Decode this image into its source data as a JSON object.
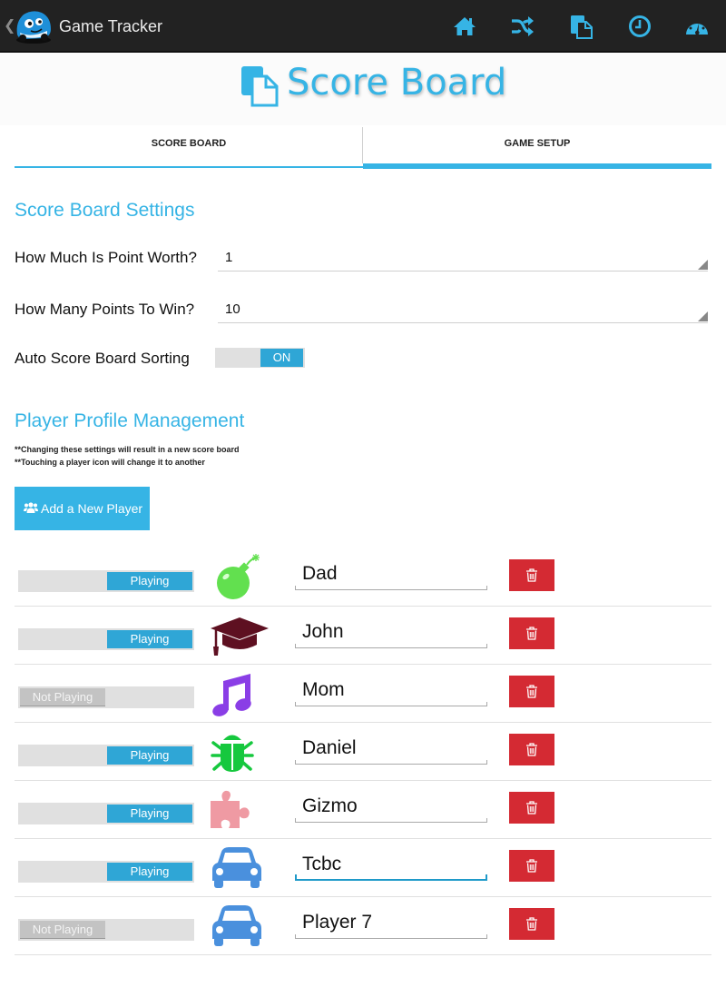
{
  "action_bar": {
    "title": "Game Tracker",
    "back_icon": "chevron-left-icon",
    "logo_icon": "car-mascot-icon",
    "actions": [
      {
        "name": "home",
        "icon": "home-icon"
      },
      {
        "name": "shuffle",
        "icon": "shuffle-icon"
      },
      {
        "name": "score-board",
        "icon": "documents-icon"
      },
      {
        "name": "history",
        "icon": "clock-icon"
      },
      {
        "name": "dashboard",
        "icon": "speedometer-icon"
      }
    ],
    "accent": "#36b4e5"
  },
  "header": {
    "title": "Score Board",
    "icon": "documents-icon"
  },
  "tabs": [
    {
      "label": "SCORE BOARD",
      "selected": false
    },
    {
      "label": "GAME SETUP",
      "selected": true
    }
  ],
  "settings": {
    "section_title": "Score Board Settings",
    "point_worth": {
      "label": "How Much Is Point Worth?",
      "value": "1"
    },
    "points_to_win": {
      "label": "How Many Points To Win?",
      "value": "10"
    },
    "auto_sort": {
      "label": "Auto Score Board Sorting",
      "state": "ON"
    }
  },
  "players_section": {
    "title": "Player Profile Management",
    "notes": [
      "**Changing these settings will result in a new score board",
      "**Touching a player icon will change it to another"
    ],
    "add_button": {
      "label": "Add a New Player",
      "icon": "users-icon"
    },
    "players": [
      {
        "status": "Playing",
        "playing": true,
        "icon": "bomb-icon",
        "icon_color": "#62e04f",
        "name": "Dad",
        "focused": false
      },
      {
        "status": "Playing",
        "playing": true,
        "icon": "graduation-cap-icon",
        "icon_color": "#5e1021",
        "name": "John",
        "focused": false
      },
      {
        "status": "Not Playing",
        "playing": false,
        "icon": "music-note-icon",
        "icon_color": "#8a3ee6",
        "name": "Mom",
        "focused": false
      },
      {
        "status": "Playing",
        "playing": true,
        "icon": "bug-icon",
        "icon_color": "#16c83e",
        "name": "Daniel",
        "focused": false
      },
      {
        "status": "Playing",
        "playing": true,
        "icon": "puzzle-piece-icon",
        "icon_color": "#ef9aa3",
        "name": "Gizmo",
        "focused": false
      },
      {
        "status": "Playing",
        "playing": true,
        "icon": "car-icon",
        "icon_color": "#4a90dd",
        "name": "Tcbc",
        "focused": true
      },
      {
        "status": "Not Playing",
        "playing": false,
        "icon": "car-icon",
        "icon_color": "#4a90dd",
        "name": "Player 7",
        "focused": false
      }
    ],
    "delete_icon": "trash-icon",
    "delete_color": "#d42a33"
  }
}
